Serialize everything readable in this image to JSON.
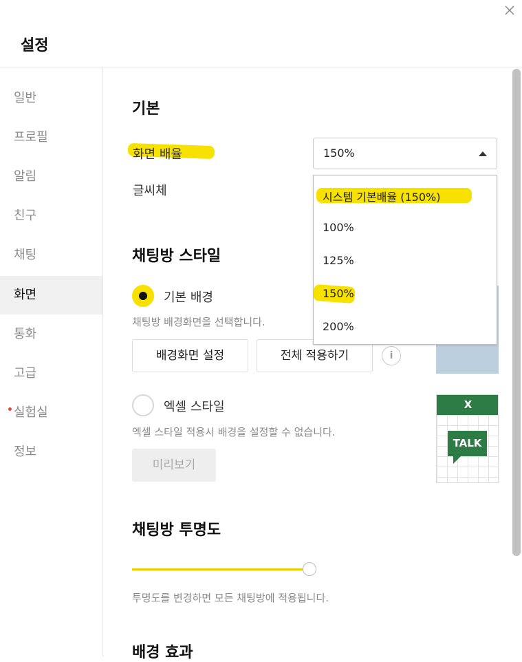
{
  "window": {
    "title": "설정"
  },
  "sidebar": {
    "items": [
      {
        "label": "일반"
      },
      {
        "label": "프로필"
      },
      {
        "label": "알림"
      },
      {
        "label": "친구"
      },
      {
        "label": "채팅"
      },
      {
        "label": "화면",
        "active": true
      },
      {
        "label": "통화"
      },
      {
        "label": "고급"
      },
      {
        "label": "실험실",
        "badge_dot": true
      },
      {
        "label": "정보"
      }
    ]
  },
  "basic": {
    "heading": "기본",
    "zoom_label": "화면 배율",
    "zoom_value": "150%",
    "font_label": "글씨체",
    "dropdown_options": [
      "시스템 기본배율 (150%)",
      "100%",
      "125%",
      "150%",
      "200%"
    ]
  },
  "chat_style": {
    "heading": "채팅방 스타일",
    "basic_bg": {
      "label": "기본 배경",
      "selected": true,
      "hint": "채팅방 배경화면을 선택합니다.",
      "set_bg_button": "배경화면 설정",
      "apply_all_button": "전체 적용하기",
      "info_icon": "i"
    },
    "excel_style": {
      "label": "엑셀 스타일",
      "selected": false,
      "hint": "엑셀 스타일 적용시 배경을 설정할 수 없습니다.",
      "preview_button": "미리보기",
      "thumb_header": "X",
      "thumb_bubble": "TALK"
    }
  },
  "opacity": {
    "heading": "채팅방 투명도",
    "value_fraction": 1.0,
    "hint": "투명도를 변경하면 모든 채팅방에 적용됩니다."
  },
  "bg_effect": {
    "heading": "배경 효과"
  },
  "colors": {
    "accent_yellow": "#f7e100",
    "excel_green": "#2e7c45",
    "bg_thumb_blue": "#bccfdf",
    "red_dot": "#e84a3a"
  }
}
